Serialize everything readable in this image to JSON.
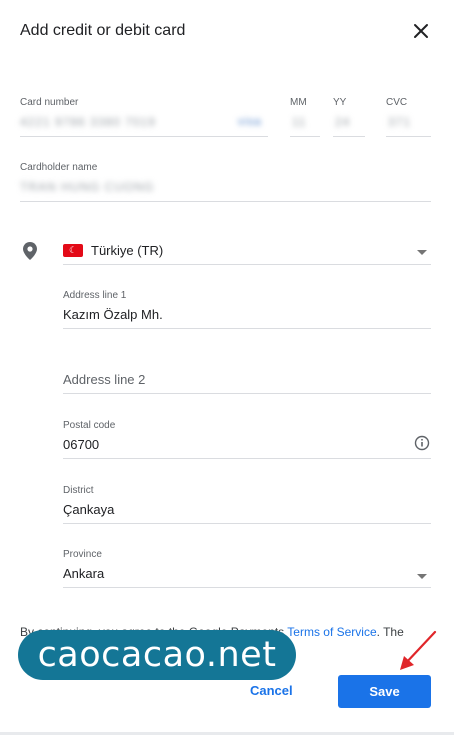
{
  "dialog": {
    "title": "Add credit or debit card",
    "close_icon": "close-icon"
  },
  "card": {
    "number_label": "Card number",
    "number_value": "4221 9786 3380 7019",
    "brand": "visa",
    "mm_label": "MM",
    "mm_value": "11",
    "yy_label": "YY",
    "yy_value": "24",
    "cvc_label": "CVC",
    "cvc_value": "371",
    "holder_label": "Cardholder name",
    "holder_value": "TRAN HUNG CUONG"
  },
  "address": {
    "location_icon": "location-pin-icon",
    "country": "Türkiye (TR)",
    "line1_label": "Address line 1",
    "line1_value": "Kazım Özalp Mh.",
    "line2_placeholder": "Address line 2",
    "postal_label": "Postal code",
    "postal_value": "06700",
    "district_label": "District",
    "district_value": "Çankaya",
    "province_label": "Province",
    "province_value": "Ankara"
  },
  "footer": {
    "terms_prefix": "By continuing, you agree to the Google Payments ",
    "terms_link": "Terms of Service",
    "terms_suffix": ". The",
    "cancel_label": "Cancel",
    "save_label": "Save"
  },
  "watermark": "caocacao.net",
  "colors": {
    "accent": "#1a73e8",
    "flag": "#e30a17",
    "arrow": "#e0262a",
    "watermark_bg": "#147696"
  }
}
